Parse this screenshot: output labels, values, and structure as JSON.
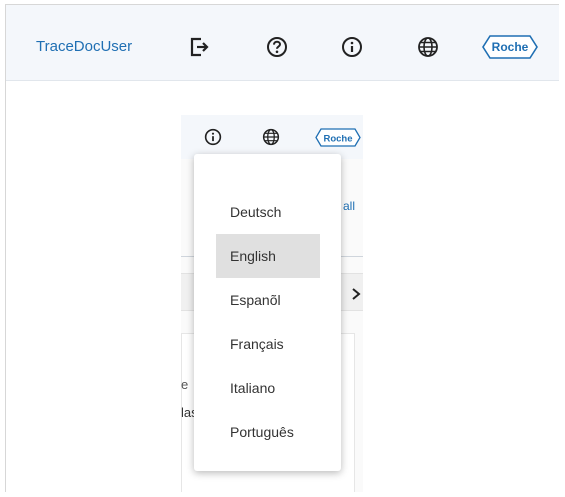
{
  "header": {
    "user_link": "TraceDocUser",
    "logo_text": "Roche",
    "icons": [
      "logout-icon",
      "help-icon",
      "info-icon",
      "globe-icon",
      "roche-logo"
    ]
  },
  "embedded_page": {
    "logo_text": "Roche",
    "partial_link": "all",
    "fragment_1": "e",
    "fragment_2": "las"
  },
  "language_menu": {
    "items": [
      "Deutsch",
      "English",
      "Espanõl",
      "Français",
      "Italiano",
      "Português"
    ],
    "selected": "English"
  },
  "colors": {
    "link": "#1f6fb3",
    "header_bg": "#f4f7fb",
    "selected_bg": "#e0e0e0"
  }
}
